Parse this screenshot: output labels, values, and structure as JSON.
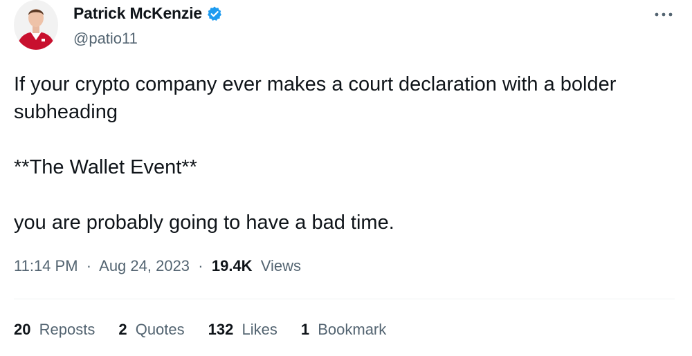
{
  "author": {
    "display_name": "Patrick McKenzie",
    "handle": "@patio11",
    "verified": true,
    "verified_color": "#1d9bf0"
  },
  "tweet": {
    "lines": [
      "If your crypto company ever makes a court declaration with a bolder",
      "subheading",
      "",
      "**The Wallet Event**",
      "",
      "you are probably going to have a bad time."
    ]
  },
  "meta": {
    "time": "11:14 PM",
    "separator": "·",
    "date": "Aug 24, 2023",
    "views_count": "19.4K",
    "views_label": "Views"
  },
  "stats": {
    "reposts": {
      "count": "20",
      "label": "Reposts"
    },
    "quotes": {
      "count": "2",
      "label": "Quotes"
    },
    "likes": {
      "count": "132",
      "label": "Likes"
    },
    "bookmarks": {
      "count": "1",
      "label": "Bookmark"
    }
  },
  "icons": {
    "verified": "verified-badge-icon",
    "more": "more-options-icon"
  },
  "colors": {
    "text_primary": "#0f1419",
    "text_secondary": "#536471",
    "divider": "#eff3f4",
    "accent": "#1d9bf0"
  }
}
